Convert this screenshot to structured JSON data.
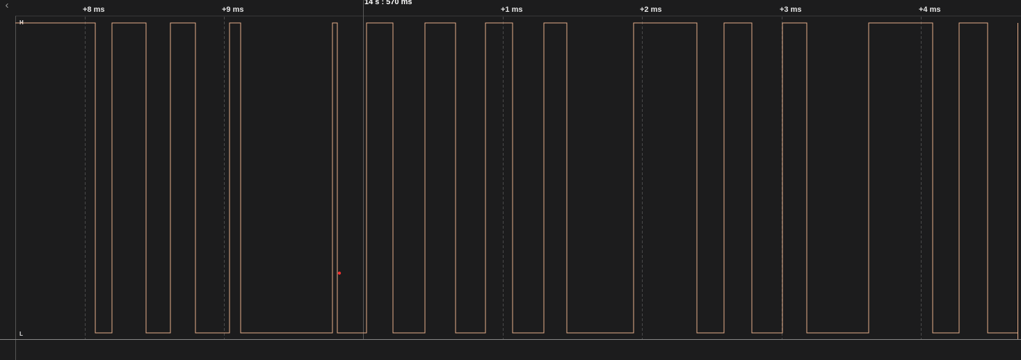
{
  "timeline": {
    "marker_label": "14 s : 570 ms",
    "ticks": [
      "+8 ms",
      "+9 ms",
      "+1 ms",
      "+2 ms",
      "+3 ms",
      "+4 ms"
    ]
  },
  "channel": {
    "high_label": "H",
    "low_label": "L",
    "trace_color": "#e8b08c",
    "cursor_color": "#ff3030"
  },
  "icons": {
    "collapse": "chevron-left-icon"
  },
  "colors": {
    "background": "#1c1c1d",
    "grid": "#4a4a4a",
    "separator": "#8a8a8a"
  }
}
